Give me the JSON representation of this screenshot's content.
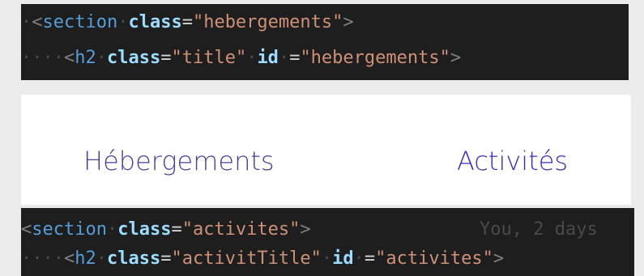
{
  "code_top": {
    "line1": {
      "indent": "·",
      "open": "<",
      "tag": "section",
      "sp1": "·",
      "attr1": "class",
      "eq1": "=",
      "val1": "\"hebergements\"",
      "close": ">"
    },
    "line2": {
      "indent": "····",
      "open": "<",
      "tag": "h2",
      "sp1": "·",
      "attr1": "class",
      "eq1": "=",
      "val1": "\"title\"",
      "sp2": "·",
      "attr2": "id",
      "sp3": "·",
      "eq2": "=",
      "val2": "\"hebergements\"",
      "close": ">"
    }
  },
  "preview": {
    "nav": [
      {
        "label": "Hébergements"
      },
      {
        "label": "Activités"
      }
    ]
  },
  "code_bottom": {
    "line1": {
      "indent": "",
      "open": "<",
      "tag": "section",
      "sp1": "·",
      "attr1": "class",
      "eq1": "=",
      "val1": "\"activites\"",
      "close": ">",
      "blame": "You, 2 days"
    },
    "line2": {
      "indent": "····",
      "open": "<",
      "tag": "h2",
      "sp1": "·",
      "attr1": "class",
      "eq1": "=",
      "val1": "\"activitTitle\"",
      "sp2": "·",
      "attr2": "id",
      "sp3": "·",
      "eq2": "=",
      "val2": "\"activites\"",
      "close": ">"
    }
  },
  "colors": {
    "editor_bg": "#1e1e1e",
    "tag": "#569cd6",
    "attribute": "#9cdcfe",
    "string": "#ce9178",
    "link": "#4b3f9a"
  }
}
